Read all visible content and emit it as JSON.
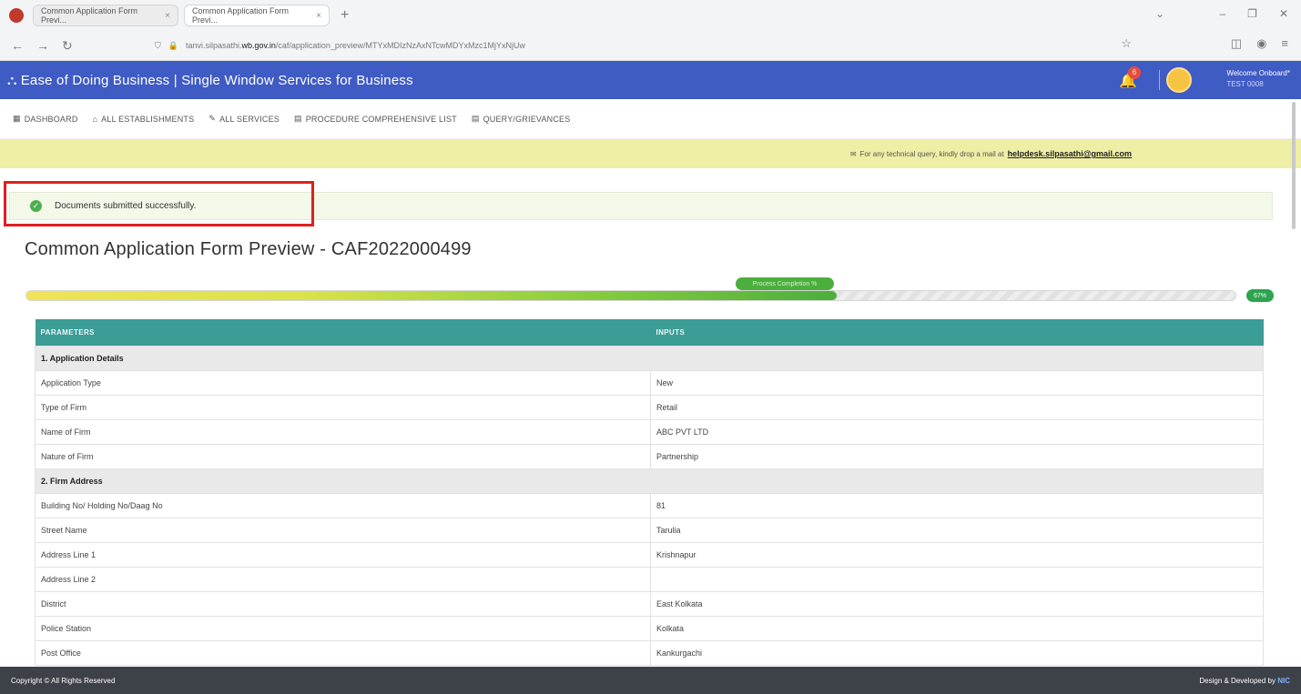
{
  "browser": {
    "tabs": [
      {
        "title": "Common Application Form Previ...",
        "close": "×"
      },
      {
        "title": "Common Application Form Previ...",
        "close": "×"
      }
    ],
    "new_tab": "+",
    "url_prefix": "tanvi.silpasathi.",
    "url_domain": "wb.gov.in",
    "url_suffix": "/caf/application_preview/MTYxMDIzNzAxNTcwMDYxMzc1MjYxNjUw"
  },
  "topbar": {
    "brand": "Ease of Doing Business | Single Window Services for Business",
    "notification_count": "6",
    "welcome_label": "Welcome Onboard*",
    "user_name": "TEST 0008"
  },
  "menu": {
    "items": [
      "DASHBOARD",
      "ALL ESTABLISHMENTS",
      "ALL SERVICES",
      "PROCEDURE COMPREHENSIVE LIST",
      "QUERY/GRIEVANCES"
    ]
  },
  "notice": {
    "text": "For any technical query, kindly drop a mail at",
    "email": "helpdesk.silpasathi@gmail.com"
  },
  "alert": {
    "message": "Documents submitted successfully."
  },
  "page": {
    "title": "Common Application Form Preview - CAF2022000499"
  },
  "progress": {
    "value_percent": 67,
    "tooltip": "Process Completion %",
    "label": "67%"
  },
  "table": {
    "headers": [
      "PARAMETERS",
      "INPUTS"
    ],
    "rows": [
      {
        "section": "1. Application Details"
      },
      {
        "param": "Application Type",
        "input": "New"
      },
      {
        "param": "Type of Firm",
        "input": "Retail"
      },
      {
        "param": "Name of Firm",
        "input": "ABC PVT LTD"
      },
      {
        "param": "Nature of Firm",
        "input": "Partnership"
      },
      {
        "section": "2. Firm Address"
      },
      {
        "param": "Building No/ Holding No/Daag No",
        "input": "81"
      },
      {
        "param": "Street Name",
        "input": "Tarulia"
      },
      {
        "param": "Address Line 1",
        "input": "Krishnapur"
      },
      {
        "param": "Address Line 2",
        "input": ""
      },
      {
        "param": "District",
        "input": "East Kolkata"
      },
      {
        "param": "Police Station",
        "input": "Kolkata"
      },
      {
        "param": "Post Office",
        "input": "Kankurgachi"
      }
    ]
  },
  "footer": {
    "copyright": "Copyright © All Rights Reserved",
    "design_label": "Design & Developed by",
    "nic": "NIC"
  },
  "colors": {
    "topbar": "#3f5bc4",
    "table_header": "#3c9c96",
    "notice": "#efeea5",
    "alert_border": "#e01e1e",
    "success": "#4caf50"
  }
}
